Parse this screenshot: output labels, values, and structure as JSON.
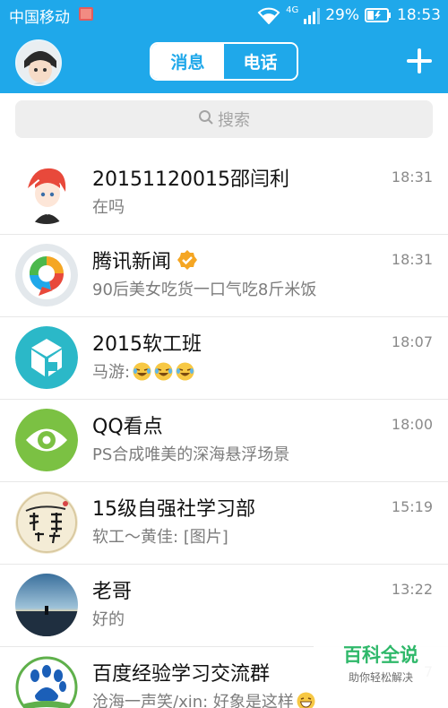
{
  "status_bar": {
    "carrier": "中国移动",
    "network": "4G",
    "battery": "29%",
    "time": "18:53"
  },
  "header": {
    "tabs": [
      {
        "label": "消息",
        "active": true
      },
      {
        "label": "电话",
        "active": false
      }
    ],
    "add_icon": "plus-icon"
  },
  "search": {
    "placeholder": "搜索",
    "icon": "search-icon"
  },
  "conversations": [
    {
      "name": "20151120015邵闫利",
      "message": "在吗",
      "time": "18:31"
    },
    {
      "name": "腾讯新闻",
      "verified": true,
      "message": "90后美女吃货一口气吃8斤米饭",
      "time": "18:31"
    },
    {
      "name": "2015软工班",
      "message": "马游: ",
      "emojis": [
        "laughing-crying-emoji",
        "laughing-crying-emoji",
        "laughing-crying-emoji"
      ],
      "time": "18:07"
    },
    {
      "name": "QQ看点",
      "message": "PS合成唯美的深海悬浮场景",
      "time": "18:00"
    },
    {
      "name": "15级自强社学习部",
      "message": "软工～黄佳: [图片]",
      "time": "15:19"
    },
    {
      "name": "老哥",
      "message": "好的",
      "time": "13:22"
    },
    {
      "name": "百度经验学习交流群",
      "message": "沧海一声笑/xin: 好象是这样",
      "emojis": [
        "grinning-emoji"
      ],
      "time": "7"
    }
  ],
  "watermark": {
    "title": "百科全说",
    "subtitle": "助你轻松解决"
  },
  "colors": {
    "brand_blue": "#1fa8ea",
    "tencent_news_orange": "#f5a623",
    "qq_kandian_green": "#7bc143",
    "class_teal": "#2bb8c8"
  }
}
